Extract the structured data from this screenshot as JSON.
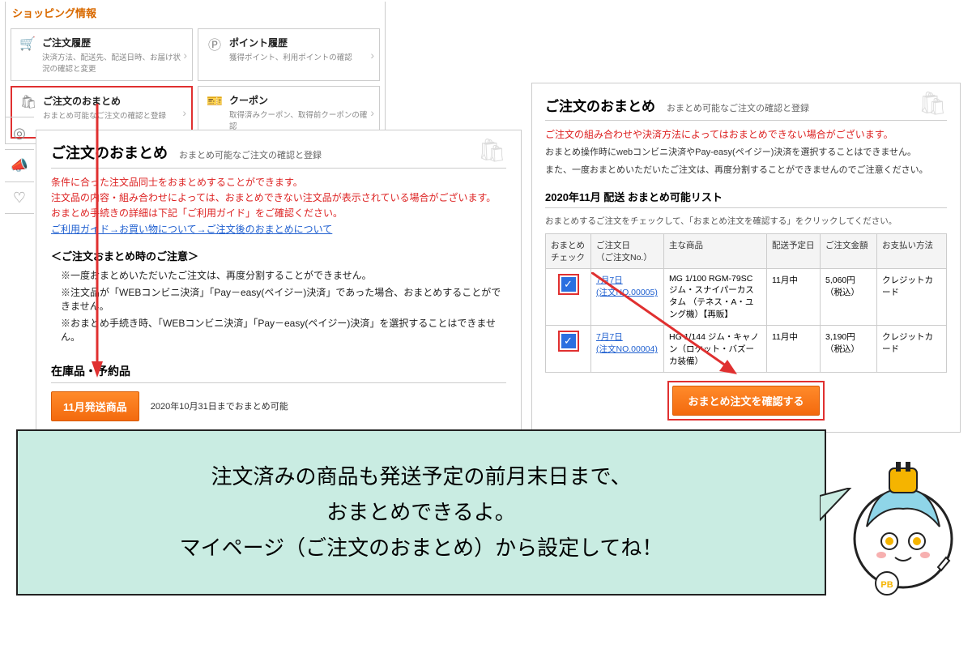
{
  "shopping_info": {
    "title": "ショッピング情報",
    "cards": [
      {
        "title": "ご注文履歴",
        "sub": "決済方法、配送先、配送日時、お届け状況の確認と変更",
        "icon": "cart"
      },
      {
        "title": "ポイント履歴",
        "sub": "獲得ポイント、利用ポイントの確認",
        "icon": "P"
      },
      {
        "title": "ご注文のおまとめ",
        "sub": "おまとめ可能なご注文の確認と登録",
        "icon": "bags",
        "highlight": true
      },
      {
        "title": "クーポン",
        "sub": "取得済みクーポン、取得前クーポンの確認",
        "icon": "ticket"
      }
    ]
  },
  "left": {
    "title": "ご注文のおまとめ",
    "sub": "おまとめ可能なご注文の確認と登録",
    "red1": "条件に合った注文品同士をおまとめすることができます。",
    "red2": "注文品の内容・組み合わせによっては、おまとめできない注文品が表示されている場合がございます。",
    "red3": "おまとめ手続きの詳細は下記「ご利用ガイド」をご確認ください。",
    "link": "ご利用ガイド→お買い物について→ご注文後のおまとめについて",
    "notice_title": "＜ご注文おまとめ時のご注意＞",
    "n1": "※一度おまとめいただいたご注文は、再度分割することができません。",
    "n2": "※注文品が「WEBコンビニ決済」「Pay－easy(ペイジー)決済」であった場合、おまとめすることができません。",
    "n3": "※おまとめ手続き時、「WEBコンビニ決済」「Pay－easy(ペイジー)決済」を選択することはできません。",
    "stock_head": "在庫品・予約品",
    "month_btn": "11月発送商品",
    "month_note": "2020年10月31日までおまとめ可能"
  },
  "right": {
    "title": "ご注文のおまとめ",
    "sub": "おまとめ可能なご注文の確認と登録",
    "red": "ご注文の組み合わせや決済方法によってはおまとめできない場合がございます。",
    "b1": "おまとめ操作時にwebコンビニ決済やPay-easy(ペイジー)決済を選択することはできません。",
    "b2": "また、一度おまとめいただいたご注文は、再度分割することができませんのでご注意ください。",
    "list_title": "2020年11月 配送 おまとめ可能リスト",
    "hint": "おまとめするご注文をチェックして、「おまとめ注文を確認する」をクリックしてください。",
    "headers": [
      "おまとめ\nチェック",
      "ご注文日\n（ご注文No.）",
      "主な商品",
      "配送予定日",
      "ご注文金額",
      "お支払い方法"
    ],
    "rows": [
      {
        "date": "7月7日",
        "no": "(注文NO.00005)",
        "product": "MG 1/100 RGM-79SC ジム・スナイパーカスタム （テネス・A・ユング機）【再販】",
        "ship": "11月中",
        "price": "5,060円（税込）",
        "pay": "クレジットカード"
      },
      {
        "date": "7月7日",
        "no": "(注文NO.00004)",
        "product": "HG 1/144 ジム・キャノン（ロケット・バズーカ装備）",
        "ship": "11月中",
        "price": "3,190円（税込）",
        "pay": "クレジットカード"
      }
    ],
    "confirm": "おまとめ注文を確認する"
  },
  "bubble": {
    "l1": "注文済みの商品も発送予定の前月末日まで、",
    "l2": "おまとめできるよ。",
    "l3": "マイページ（ご注文のおまとめ）から設定してね！"
  }
}
